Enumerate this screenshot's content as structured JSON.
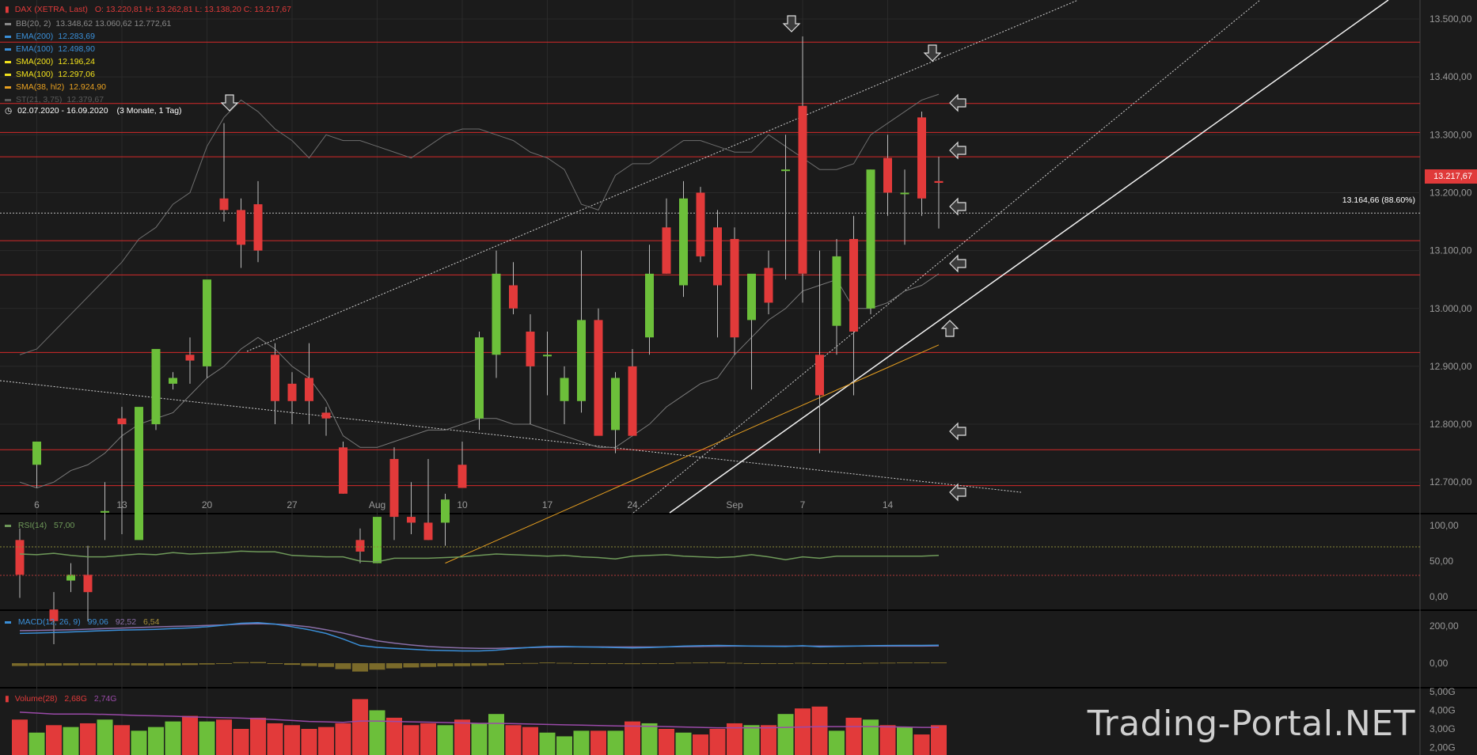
{
  "header": {
    "instrument": "DAX (XETRA, Last)",
    "ohlc": "O: 13.220,81  H: 13.262,81  L: 13.138,20  C: 13.217,67",
    "date_range": "02.07.2020 - 16.09.2020",
    "range_info": "(3 Monate, 1 Tag)"
  },
  "indicators": [
    {
      "label": "BB(20, 2)",
      "value": "13.348,62  13.060,62  12.772,61",
      "color": "#8a8a8a"
    },
    {
      "label": "EMA(200)",
      "value": "12.283,69",
      "color": "#3a8fd8"
    },
    {
      "label": "EMA(100)",
      "value": "12.498,90",
      "color": "#3a8fd8"
    },
    {
      "label": "SMA(200)",
      "value": "12.196,24",
      "color": "#f2e21c"
    },
    {
      "label": "SMA(100)",
      "value": "12.297,06",
      "color": "#f2e21c"
    },
    {
      "label": "SMA(38, hl2)",
      "value": "12.924,90",
      "color": "#e8a020"
    },
    {
      "label": "ST(21, 3,75)",
      "value": "12.379,67",
      "color": "#5a5a5a"
    }
  ],
  "last_price": "13.217,67",
  "fib_label": "13.164,66 (88.60%)",
  "watermark": "Trading-Portal.NET",
  "panes": {
    "rsi": {
      "label": "RSI(14)",
      "value": "57,00",
      "color": "#6f9a5a",
      "ticks": [
        "100,00",
        "50,00",
        "0,00"
      ]
    },
    "macd": {
      "label": "MACD(12, 26, 9)",
      "v1": "99,06",
      "v2": "92,52",
      "v3": "6,54",
      "ticks": [
        "200,00",
        "0,00"
      ]
    },
    "volume": {
      "label": "Volume(28)",
      "v1": "2,68G",
      "v2": "2,74G",
      "ticks": [
        "5,00G",
        "4,00G",
        "3,00G",
        "2,00G"
      ]
    }
  },
  "colors": {
    "up": "#6cbf3a",
    "down": "#e23a3a",
    "background": "#1b1b1b",
    "grid": "#2a2a2a",
    "level": "#d42a2a"
  },
  "chart_data": {
    "type": "candlestick",
    "price_axis_ticks": [
      "13.500,00",
      "13.400,00",
      "13.300,00",
      "13.200,00",
      "13.100,00",
      "13.000,00",
      "12.900,00",
      "12.800,00",
      "12.700,00"
    ],
    "x_ticks": [
      {
        "label": "6",
        "i": 1
      },
      {
        "label": "13",
        "i": 6
      },
      {
        "label": "20",
        "i": 11
      },
      {
        "label": "27",
        "i": 16
      },
      {
        "label": "Aug",
        "i": 21
      },
      {
        "label": "10",
        "i": 26
      },
      {
        "label": "17",
        "i": 31
      },
      {
        "label": "24",
        "i": 36
      },
      {
        "label": "Sep",
        "i": 42
      },
      {
        "label": "7",
        "i": 46
      },
      {
        "label": "14",
        "i": 51
      }
    ],
    "candles": [
      [
        12600,
        12620,
        12500,
        12540
      ],
      [
        12730,
        12760,
        12690,
        12770
      ],
      [
        12480,
        12510,
        12420,
        12460
      ],
      [
        12530,
        12560,
        12510,
        12540
      ],
      [
        12540,
        12590,
        12460,
        12510
      ],
      [
        12650,
        12700,
        12600,
        12650
      ],
      [
        12810,
        12830,
        12610,
        12800
      ],
      [
        12600,
        12680,
        12680,
        12830
      ],
      [
        12800,
        12930,
        12790,
        12930
      ],
      [
        12870,
        12890,
        12860,
        12880
      ],
      [
        12920,
        12950,
        12870,
        12910
      ],
      [
        12900,
        12900,
        12880,
        13050
      ],
      [
        13190,
        13320,
        13150,
        13170
      ],
      [
        13170,
        13190,
        13070,
        13110
      ],
      [
        13180,
        13220,
        13080,
        13100
      ],
      [
        12920,
        12940,
        12800,
        12840
      ],
      [
        12870,
        12890,
        12800,
        12840
      ],
      [
        12880,
        12940,
        12800,
        12840
      ],
      [
        12820,
        12830,
        12780,
        12810
      ],
      [
        12760,
        12770,
        12680,
        12680
      ],
      [
        12600,
        12620,
        12560,
        12580
      ],
      [
        12560,
        12620,
        12560,
        12640
      ],
      [
        12740,
        12760,
        12600,
        12640
      ],
      [
        12640,
        12700,
        12610,
        12630
      ],
      [
        12630,
        12740,
        12600,
        12600
      ],
      [
        12630,
        12680,
        12590,
        12670
      ],
      [
        12730,
        12770,
        12700,
        12690
      ],
      [
        12810,
        12960,
        12790,
        12950
      ],
      [
        12920,
        13100,
        12880,
        13060
      ],
      [
        13040,
        13080,
        12990,
        13000
      ],
      [
        12960,
        12990,
        12800,
        12900
      ],
      [
        12920,
        12960,
        12850,
        12920
      ],
      [
        12840,
        12900,
        12800,
        12880
      ],
      [
        12840,
        13100,
        12820,
        12980
      ],
      [
        12980,
        13000,
        12790,
        12780
      ],
      [
        12790,
        12890,
        12750,
        12880
      ],
      [
        12900,
        12930,
        12790,
        12780
      ],
      [
        12950,
        13110,
        12920,
        13060
      ],
      [
        13140,
        13190,
        13060,
        13060
      ],
      [
        13040,
        13220,
        13020,
        13190
      ],
      [
        13200,
        13210,
        13080,
        13090
      ],
      [
        13140,
        13170,
        12950,
        13040
      ],
      [
        13120,
        13140,
        12920,
        12950
      ],
      [
        12980,
        13050,
        12860,
        13060
      ],
      [
        13070,
        13100,
        12990,
        13010
      ],
      [
        13240,
        13300,
        13050,
        13240
      ],
      [
        13350,
        13470,
        13010,
        13060
      ],
      [
        12920,
        13100,
        12750,
        12850
      ],
      [
        12970,
        13120,
        12920,
        13090
      ],
      [
        13120,
        13160,
        12850,
        12960
      ],
      [
        13000,
        13240,
        12990,
        13240
      ],
      [
        13260,
        13300,
        13160,
        13200
      ],
      [
        13200,
        13240,
        13110,
        13200
      ],
      [
        13330,
        13340,
        13160,
        13190
      ],
      [
        13220,
        13262,
        13138,
        13217
      ]
    ],
    "horizontal_levels": [
      13460,
      13354,
      13304,
      13262,
      13117,
      13058,
      12924,
      12756,
      12694
    ],
    "fib_level": 13164.66,
    "rsi_values": [
      60,
      59,
      61,
      58,
      56,
      56,
      58,
      60,
      59,
      62,
      60,
      61,
      62,
      64,
      63,
      63,
      58,
      57,
      56,
      56,
      50,
      49,
      54,
      54,
      54,
      55,
      56,
      58,
      60,
      59,
      58,
      57,
      58,
      56,
      55,
      53,
      57,
      58,
      59,
      57,
      56,
      55,
      56,
      59,
      56,
      52,
      56,
      54,
      57,
      57,
      57,
      57,
      57,
      57,
      58
    ],
    "macd_line": [
      160,
      162,
      165,
      168,
      172,
      175,
      178,
      180,
      182,
      186,
      190,
      196,
      205,
      215,
      218,
      210,
      196,
      180,
      160,
      130,
      95,
      85,
      80,
      75,
      70,
      68,
      66,
      66,
      70,
      78,
      85,
      90,
      90,
      88,
      86,
      84,
      82,
      84,
      88,
      92,
      94,
      96,
      94,
      92,
      91,
      90,
      94,
      88,
      90,
      92,
      94,
      95,
      96,
      96,
      97
    ],
    "macd_signal": [
      175,
      176,
      178,
      180,
      183,
      186,
      189,
      192,
      195,
      198,
      200,
      203,
      206,
      210,
      212,
      210,
      205,
      195,
      180,
      162,
      140,
      120,
      108,
      98,
      90,
      85,
      82,
      80,
      80,
      82,
      84,
      86,
      88,
      88,
      88,
      87,
      87,
      87,
      88,
      89,
      90,
      91,
      92,
      92,
      92,
      92,
      92,
      92,
      92,
      92,
      92,
      92,
      92,
      92,
      93
    ],
    "macd_hist": [
      -15,
      -14,
      -13,
      -12,
      -11,
      -11,
      -11,
      -12,
      -13,
      -12,
      -10,
      -7,
      -1,
      5,
      6,
      0,
      -9,
      -15,
      -20,
      -32,
      -45,
      -35,
      -28,
      -23,
      -20,
      -17,
      -16,
      -14,
      -10,
      -4,
      1,
      4,
      2,
      0,
      -2,
      -3,
      -5,
      -3,
      0,
      3,
      4,
      5,
      2,
      0,
      -1,
      -2,
      2,
      -4,
      -2,
      0,
      2,
      3,
      4,
      4,
      4
    ],
    "volume_values": [
      3.5,
      2.8,
      3.2,
      3.1,
      3.3,
      3.5,
      3.2,
      2.9,
      3.1,
      3.4,
      3.7,
      3.4,
      3.5,
      3.0,
      3.6,
      3.3,
      3.2,
      3.0,
      3.1,
      3.3,
      4.6,
      4.0,
      3.6,
      3.2,
      3.3,
      3.2,
      3.5,
      3.3,
      3.8,
      3.2,
      3.1,
      2.8,
      2.6,
      2.9,
      2.9,
      2.9,
      3.4,
      3.3,
      3.0,
      2.8,
      2.7,
      3.0,
      3.3,
      3.2,
      3.2,
      3.8,
      4.1,
      4.2,
      2.9,
      3.6,
      3.5,
      3.2,
      3.1,
      2.7,
      3.2
    ],
    "volume_ma": [
      3.9,
      3.85,
      3.8,
      3.8,
      3.8,
      3.78,
      3.75,
      3.72,
      3.7,
      3.68,
      3.65,
      3.62,
      3.6,
      3.58,
      3.55,
      3.5,
      3.45,
      3.4,
      3.38,
      3.35,
      3.42,
      3.42,
      3.4,
      3.38,
      3.36,
      3.34,
      3.32,
      3.3,
      3.3,
      3.28,
      3.26,
      3.24,
      3.22,
      3.2,
      3.18,
      3.16,
      3.15,
      3.14,
      3.12,
      3.1,
      3.08,
      3.06,
      3.06,
      3.06,
      3.06,
      3.08,
      3.1,
      3.12,
      3.12,
      3.12,
      3.12,
      3.11,
      3.1,
      3.08,
      3.08
    ]
  }
}
